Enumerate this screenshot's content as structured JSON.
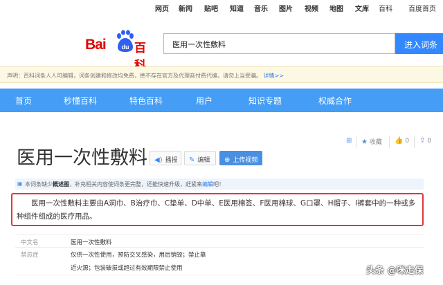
{
  "top_nav": [
    "网页",
    "新闻",
    "贴吧",
    "知道",
    "音乐",
    "图片",
    "视频",
    "地图",
    "文库",
    "百科",
    "百度首页"
  ],
  "logo": {
    "bai": "Bai",
    "du": "du",
    "baike": "百科"
  },
  "search": {
    "value": "医用一次性敷料",
    "button": "进入词条"
  },
  "notice": {
    "text": "声明：百科词条人人可编辑，词条创建和修改均免费，绝不存在官方及代理商付费代编，请勿上当受骗。",
    "more": "详情>>"
  },
  "blue_nav": [
    "首页",
    "秒懂百科",
    "特色百科",
    "用户",
    "知识专题",
    "权威合作"
  ],
  "title": "医用一次性敷料",
  "title_buttons": {
    "report": "播报",
    "edit": "编辑",
    "upload": "上传视频"
  },
  "right_tools": {
    "collect": "收藏",
    "likes": "0",
    "shares": "0"
  },
  "note": {
    "p1": "本词条缺少",
    "bold": "概述图",
    "p2": "，补充相关内容使词条更完整，还能快速升级，赶紧来",
    "link": "编辑",
    "p3": "吧！"
  },
  "summary": "医用一次性敷料主要由A洞巾、B治疗巾、C垫单、D中单、E医用棉签、F医用棉球、G口罩、H帽子、I裤套中的一种或多种组件组成的医疗用品。",
  "basic_info": [
    {
      "key": "中文名",
      "value": "医用一次性敷料"
    },
    {
      "key": "禁忌症",
      "value": "仅供一次性使用，预防交叉感染，用后销毁；禁止靠"
    },
    {
      "key": "",
      "value": "近火源；包装破损或超过有效期限禁止使用"
    }
  ],
  "watermark": "头条 @咪走保",
  "colors": {
    "brand_red": "#e10602",
    "nav_blue": "#459df5",
    "button_blue": "#3388ff",
    "highlight_red": "#e2363b"
  }
}
